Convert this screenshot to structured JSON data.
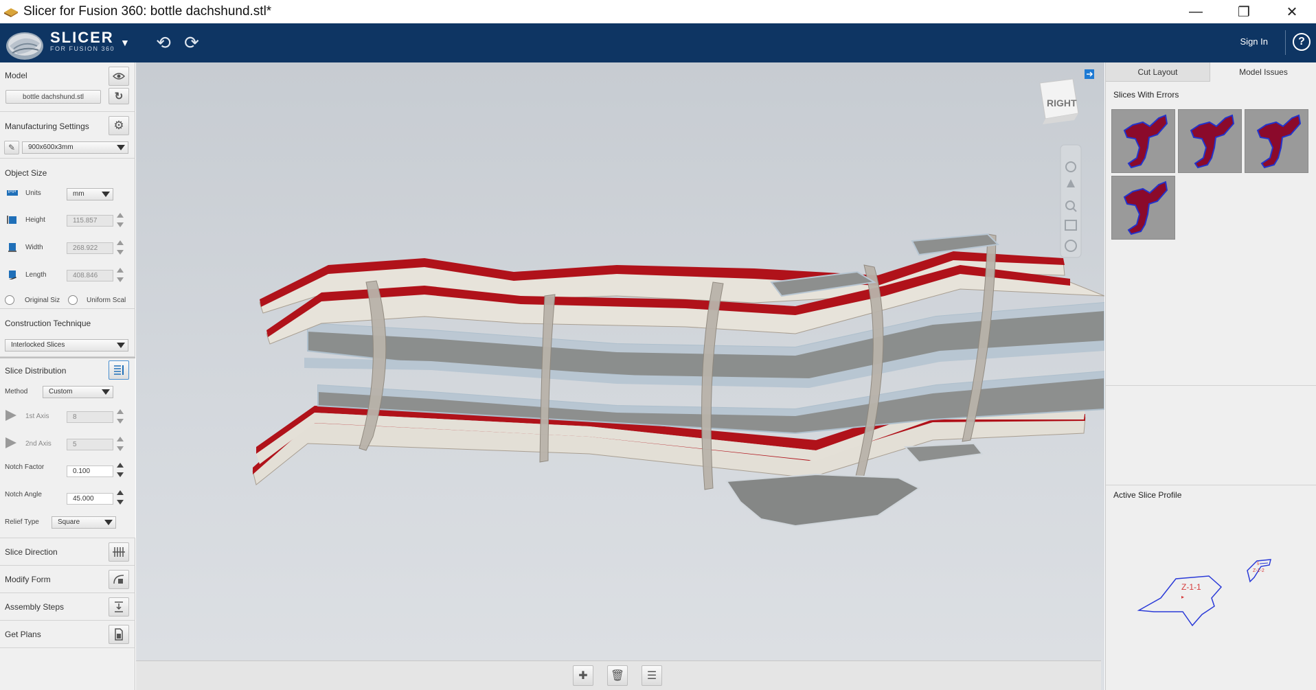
{
  "window": {
    "title": "Slicer for Fusion 360: bottle dachshund.stl*",
    "controls": [
      "minimize",
      "restore",
      "close"
    ]
  },
  "header": {
    "brand_main": "SLICER",
    "brand_sub": "FOR FUSION 360",
    "sign_in": "Sign In",
    "help": "?"
  },
  "left_panel": {
    "model": {
      "label": "Model",
      "file": "bottle dachshund.stl"
    },
    "manufacturing": {
      "label": "Manufacturing Settings",
      "preset": "900x600x3mm"
    },
    "object_size": {
      "label": "Object Size",
      "units_label": "Units",
      "units_value": "mm",
      "height_label": "Height",
      "height_value": "115.857",
      "width_label": "Width",
      "width_value": "268.922",
      "length_label": "Length",
      "length_value": "408.846",
      "original_size": "Original Siz",
      "uniform_scale": "Uniform Scal"
    },
    "construction": {
      "label": "Construction Technique",
      "value": "Interlocked Slices"
    },
    "slice_distribution": {
      "label": "Slice Distribution",
      "method_label": "Method",
      "method_value": "Custom",
      "axis1_label": "1st Axis",
      "axis1_value": "8",
      "axis2_label": "2nd Axis",
      "axis2_value": "5",
      "notch_factor_label": "Notch Factor",
      "notch_factor_value": "0.100",
      "notch_angle_label": "Notch Angle",
      "notch_angle_value": "45.000",
      "relief_type_label": "Relief Type",
      "relief_type_value": "Square"
    },
    "slice_direction": "Slice Direction",
    "modify_form": "Modify Form",
    "assembly_steps": "Assembly Steps",
    "get_plans": "Get Plans"
  },
  "viewport": {
    "view_cube_label": "RIGHT"
  },
  "right_panel": {
    "tab_cut_layout": "Cut Layout",
    "tab_model_issues": "Model Issues",
    "slices_with_errors": "Slices With Errors",
    "error_thumbnail_count": 4,
    "active_slice_profile": "Active Slice Profile",
    "profile_label_main": "Z-1-1",
    "profile_label_small": "Z-1-2",
    "profile_small_mark": "5"
  },
  "colors": {
    "header": "#0e3563",
    "slice_error_fill": "#8b0a2b",
    "slice_error_outline": "#2233cc",
    "profile_outline": "#2a3ad8",
    "profile_label": "#d63a3a"
  }
}
